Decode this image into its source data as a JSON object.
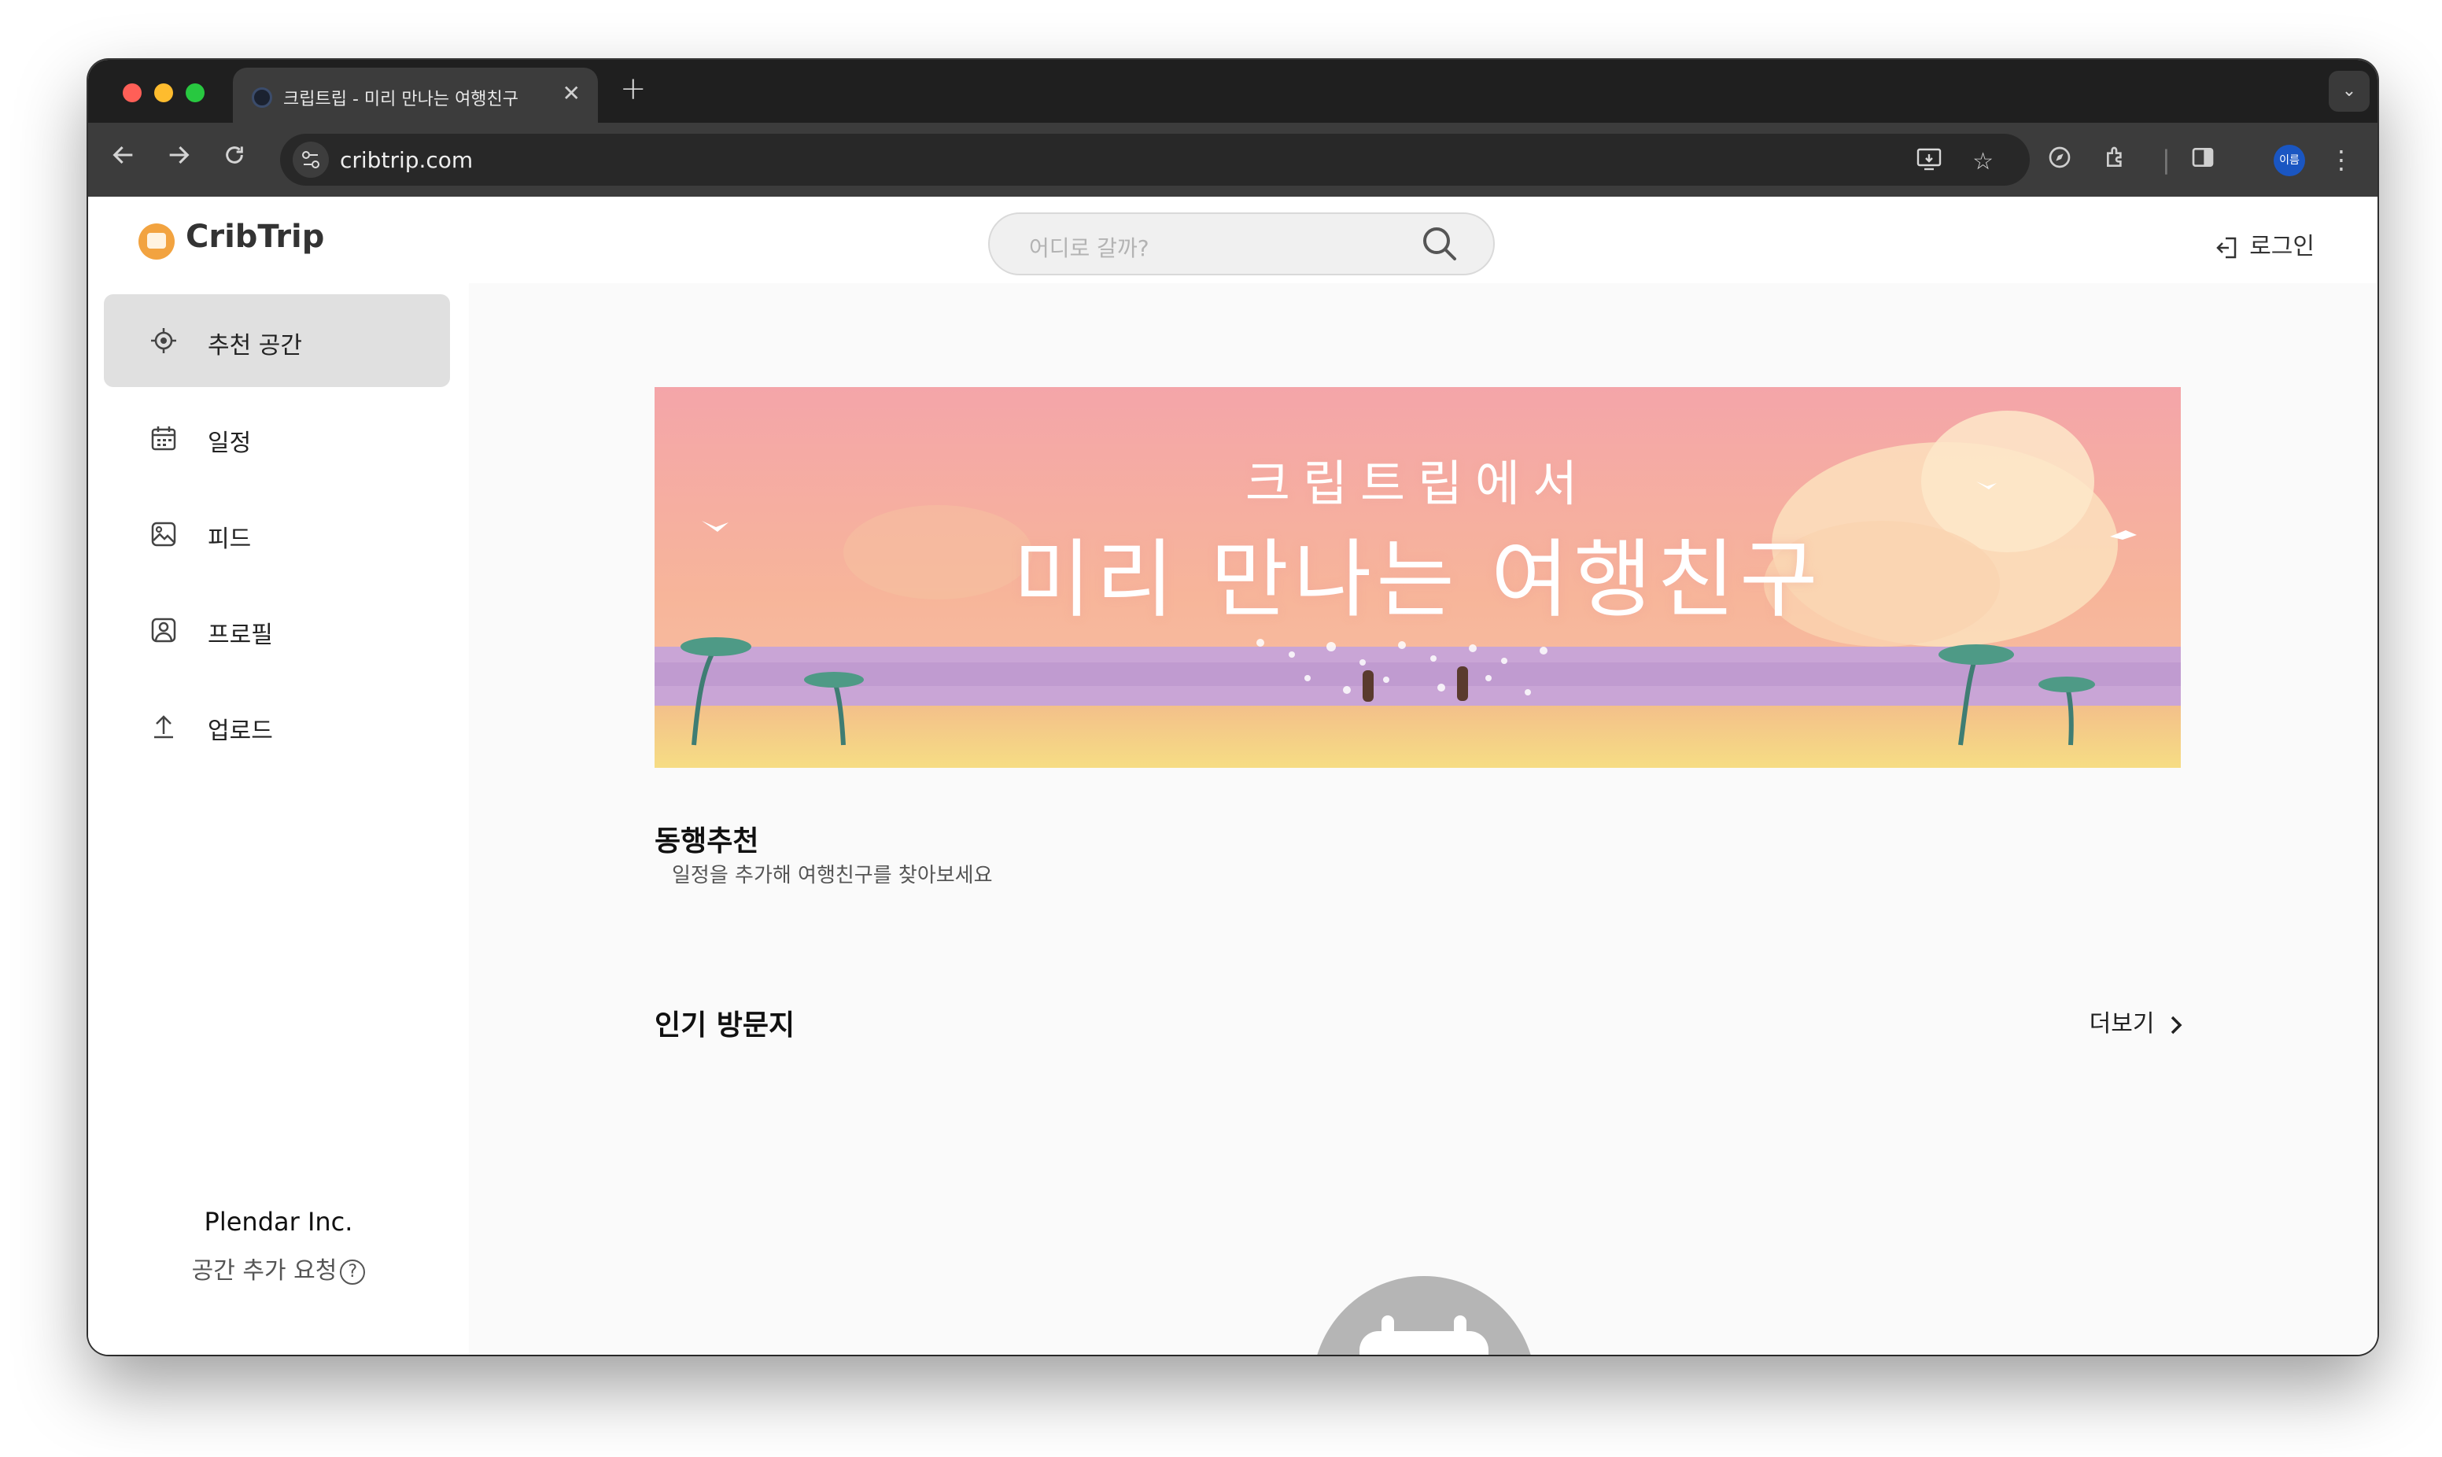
{
  "browser": {
    "tab_title": "크립트립 - 미리 만나는 여행친구",
    "tab_close": "✕",
    "new_tab": "+",
    "url": "cribtrip.com",
    "profile_label": "이름"
  },
  "header": {
    "logo_text": "CribTrip",
    "search_placeholder": "어디로 갈까?",
    "login_label": "로그인"
  },
  "sidebar": {
    "items": [
      {
        "label": "추천 공간",
        "icon": "location-target-icon",
        "active": true
      },
      {
        "label": "일정",
        "icon": "calendar-icon",
        "active": false
      },
      {
        "label": "피드",
        "icon": "image-icon",
        "active": false
      },
      {
        "label": "프로필",
        "icon": "profile-icon",
        "active": false
      },
      {
        "label": "업로드",
        "icon": "upload-icon",
        "active": false
      }
    ],
    "company": "Plendar Inc.",
    "request_label": "공간 추가 요청",
    "help_glyph": "?"
  },
  "banner": {
    "line1": "크립트립에서",
    "line2": "미리 만나는 여행친구"
  },
  "companion": {
    "title": "동행추천",
    "subtitle": "일정을 추가해 여행친구를 찾아보세요"
  },
  "popular": {
    "title": "인기 방문지",
    "more_label": "더보기"
  },
  "colors": {
    "brand": "#f2a340",
    "active_bg": "#e0e0e0",
    "placeholder_circle": "#b5b5b5"
  }
}
